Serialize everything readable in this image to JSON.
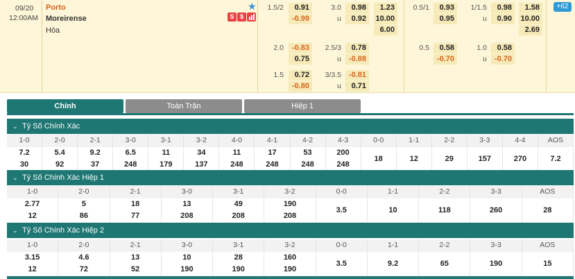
{
  "match": {
    "date": "09/20",
    "time": "12:00AM",
    "home": "Porto",
    "away": "Moreirense",
    "draw": "Hòa",
    "icons": [
      "s-icon",
      "dollar-icon",
      "stats-icon"
    ],
    "more_count": "62"
  },
  "ft": {
    "hdp_rows": [
      {
        "line": "1.5/2",
        "home": "0.91",
        "away": "-0.99"
      },
      {
        "line": "2.0",
        "home": "-0.83",
        "away": "0.75"
      },
      {
        "line": "1.5",
        "home": "0.72",
        "away": "-0.80"
      }
    ],
    "ou_rows": [
      {
        "line": "3.0",
        "over": "0.98",
        "u": "u",
        "under": "0.92"
      },
      {
        "line": "2.5/3",
        "over": "0.78",
        "u": "u",
        "under": "-0.88"
      },
      {
        "line": "3/3.5",
        "over": "-0.81",
        "u": "u",
        "under": "0.71"
      }
    ],
    "x12": [
      "1.23",
      "10.00",
      "6.00"
    ]
  },
  "h1": {
    "hdp_rows": [
      {
        "line": "0.5/1",
        "home": "0.93",
        "away": "0.95"
      },
      {
        "line": "0.5",
        "home": "0.58",
        "away": "-0.70"
      }
    ],
    "ou_rows": [
      {
        "line": "1/1.5",
        "over": "0.98",
        "u": "u",
        "under": "0.90"
      },
      {
        "line": "1.0",
        "over": "0.58",
        "u": "u",
        "under": "-0.70"
      }
    ],
    "x12": [
      "1.58",
      "10.00",
      "2.69"
    ]
  },
  "tabs": [
    "Chính",
    "Toàn Trận",
    "Hiệp 1"
  ],
  "sections": [
    {
      "title": "Tỷ Số Chính Xác",
      "headers": [
        "1-0",
        "2-0",
        "2-1",
        "3-0",
        "3-1",
        "3-2",
        "4-0",
        "4-1",
        "4-2",
        "4-3",
        "0-0",
        "1-1",
        "2-2",
        "3-3",
        "4-4",
        "AOS"
      ],
      "values": [
        [
          "7.2",
          "30"
        ],
        [
          "5.4",
          "92"
        ],
        [
          "9.2",
          "37"
        ],
        [
          "6.5",
          "248"
        ],
        [
          "11",
          "179"
        ],
        [
          "34",
          "137"
        ],
        [
          "11",
          "248"
        ],
        [
          "17",
          "248"
        ],
        [
          "53",
          "248"
        ],
        [
          "200",
          "248"
        ],
        [
          "18"
        ],
        [
          "12"
        ],
        [
          "29"
        ],
        [
          "157"
        ],
        [
          "270"
        ],
        [
          "7.2"
        ]
      ]
    },
    {
      "title": "Tỷ Số Chính Xác Hiệp 1",
      "headers": [
        "1-0",
        "2-0",
        "2-1",
        "3-0",
        "3-1",
        "3-2",
        "0-0",
        "1-1",
        "2-2",
        "3-3",
        "AOS"
      ],
      "values": [
        [
          "2.77",
          "12"
        ],
        [
          "5",
          "86"
        ],
        [
          "18",
          "77"
        ],
        [
          "13",
          "208"
        ],
        [
          "49",
          "208"
        ],
        [
          "190",
          "208"
        ],
        [
          "3.5"
        ],
        [
          "10"
        ],
        [
          "118"
        ],
        [
          "260"
        ],
        [
          "28"
        ]
      ]
    },
    {
      "title": "Tỷ Số Chính Xác Hiệp 2",
      "headers": [
        "1-0",
        "2-0",
        "2-1",
        "3-0",
        "3-1",
        "3-2",
        "0-0",
        "1-1",
        "2-2",
        "3-3",
        "AOS"
      ],
      "values": [
        [
          "3.15",
          "12"
        ],
        [
          "4.6",
          "72"
        ],
        [
          "13",
          "52"
        ],
        [
          "10",
          "190"
        ],
        [
          "28",
          "190"
        ],
        [
          "160",
          "190"
        ],
        [
          "3.5"
        ],
        [
          "9.2"
        ],
        [
          "65"
        ],
        [
          "190"
        ],
        [
          "15"
        ]
      ]
    }
  ],
  "colors": {
    "accent": "#1e7773",
    "home": "#d8661b",
    "negative": "#d8661b",
    "badge": "#2f9bd6",
    "icon": "#e64343"
  }
}
